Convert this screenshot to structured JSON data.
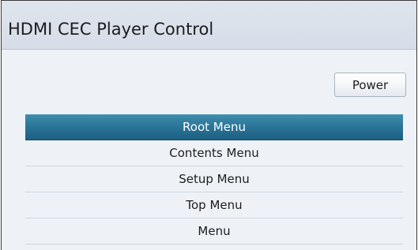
{
  "window": {
    "title": "HDMI CEC Player Control"
  },
  "controls": {
    "power_label": "Power"
  },
  "menu": {
    "items": [
      {
        "label": "Root Menu",
        "selected": true
      },
      {
        "label": "Contents Menu",
        "selected": false
      },
      {
        "label": "Setup Menu",
        "selected": false
      },
      {
        "label": "Top Menu",
        "selected": false
      },
      {
        "label": "Menu",
        "selected": false
      }
    ]
  },
  "colors": {
    "selection": "#2a7497",
    "background": "#eef2f7",
    "title_bar": "#d6dde8"
  }
}
